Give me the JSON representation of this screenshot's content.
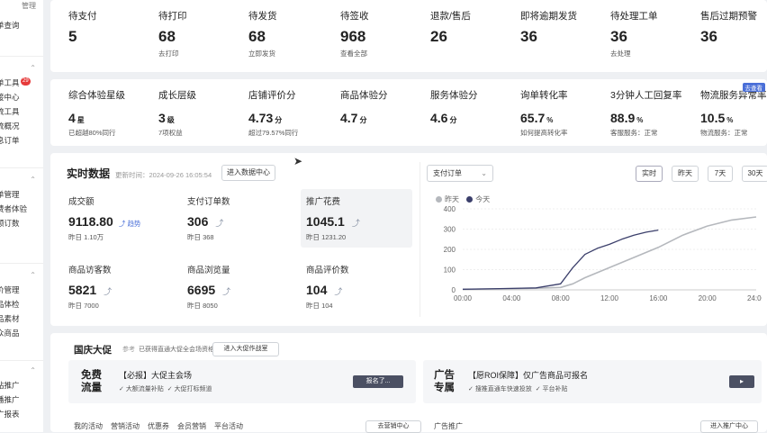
{
  "sidebar": {
    "top": "管理",
    "groups": [
      {
        "items": [
          "单查询"
        ]
      },
      {
        "items": [
          "单工具",
          "接中心",
          "流工具",
          "流概况",
          "息订单"
        ]
      },
      {
        "items": [
          "单管理",
          "费者体验",
          "额订数"
        ]
      },
      {
        "items": [
          "价管理",
          "品体检",
          "品素材",
          "众商品"
        ]
      },
      {
        "items": [
          "站推广",
          "播推广",
          "广报表"
        ]
      }
    ],
    "badge": "29"
  },
  "kpis_row1": [
    {
      "label": "待支付",
      "value": "5",
      "sub": ""
    },
    {
      "label": "待打印",
      "value": "68",
      "sub": "去打印"
    },
    {
      "label": "待发货",
      "value": "68",
      "sub": "立即发货"
    },
    {
      "label": "待签收",
      "value": "968",
      "sub": "查看全部"
    },
    {
      "label": "退款/售后",
      "value": "26",
      "sub": ""
    },
    {
      "label": "即将逾期发货",
      "value": "36",
      "sub": ""
    },
    {
      "label": "待处理工单",
      "value": "36",
      "sub": "去处理"
    },
    {
      "label": "售后过期预警",
      "value": "36",
      "sub": ""
    }
  ],
  "kpis_row2": [
    {
      "label": "综合体验星级",
      "value": "4",
      "unit": "星",
      "sub": "已超越80%同行"
    },
    {
      "label": "成长层级",
      "value": "3",
      "unit": "级",
      "sub": "7项权益"
    },
    {
      "label": "店铺评价分",
      "value": "4.73",
      "unit": "分",
      "sub": "超过79.57%同行"
    },
    {
      "label": "商品体验分",
      "value": "4.7",
      "unit": "分",
      "sub": ""
    },
    {
      "label": "服务体验分",
      "value": "4.6",
      "unit": "分",
      "sub": ""
    },
    {
      "label": "询单转化率",
      "value": "65.7",
      "unit": "%",
      "sub": "如何提高转化率"
    },
    {
      "label": "3分钟人工回复率",
      "value": "88.9",
      "unit": "%",
      "sub": "客服服务：正常"
    },
    {
      "label": "物流服务异常率",
      "value": "10.5",
      "unit": "%",
      "sub": "物流服务：正常",
      "badge": "去查看"
    }
  ],
  "realtime": {
    "title": "实时数据",
    "updated": "更新时间：2024-09-26 16:05:54",
    "enter_btn": "进入数据中心",
    "metrics": [
      {
        "name": "成交额",
        "value": "9118.80",
        "yest": "昨日 1.10万",
        "tag": "趋势"
      },
      {
        "name": "支付订单数",
        "value": "306",
        "yest": "昨日 368"
      },
      {
        "name": "推广花费",
        "value": "1045.1",
        "yest": "昨日 1231.20"
      },
      {
        "name": "商品访客数",
        "value": "5821",
        "yest": "昨日 7000"
      },
      {
        "name": "商品浏览量",
        "value": "6695",
        "yest": "昨日 8050"
      },
      {
        "name": "商品评价数",
        "value": "104",
        "yest": "昨日 104"
      }
    ],
    "chart_select": "支付订单",
    "range_buttons": [
      "实时",
      "昨天",
      "7天",
      "30天"
    ]
  },
  "chart_data": {
    "type": "line",
    "x_ticks": [
      "00:00",
      "04:00",
      "08:00",
      "12:00",
      "16:00",
      "20:00",
      "24:00"
    ],
    "y_ticks": [
      "0",
      "100",
      "200",
      "300",
      "400"
    ],
    "ylim": [
      0,
      400
    ],
    "xlim": [
      0,
      24
    ],
    "series": [
      {
        "name": "昨天",
        "color": "#b5b8bd",
        "x": [
          0,
          2,
          4,
          6,
          8,
          9,
          10,
          11,
          12,
          14,
          16,
          18,
          20,
          22,
          24
        ],
        "y": [
          2,
          4,
          6,
          8,
          12,
          30,
          60,
          85,
          110,
          160,
          210,
          270,
          315,
          345,
          360
        ]
      },
      {
        "name": "今天",
        "color": "#3b3f6b",
        "x": [
          0,
          2,
          4,
          6,
          8,
          9,
          10,
          11,
          12,
          13,
          14,
          15,
          16
        ],
        "y": [
          3,
          5,
          7,
          10,
          30,
          110,
          175,
          205,
          225,
          250,
          270,
          285,
          295
        ]
      }
    ]
  },
  "promo": {
    "title": "国庆大促",
    "tag": "参考",
    "desc": "已获得直通大促全会场资格",
    "btn": "进入大促作战室",
    "left": {
      "big": "免费流量",
      "title": "【必报】大促主会场",
      "checks": [
        "大额流量补贴",
        "大促打标频道"
      ],
      "btn": "报名了..."
    },
    "right": {
      "big": "广告专属",
      "title": "【愿ROI保障】仅广告商品可报名",
      "checks": [
        "搜推直通车快速投放",
        "平台补贴"
      ]
    }
  },
  "bottom_tabs": [
    "我的活动",
    "营销活动",
    "优惠券",
    "会员营销",
    "平台活动"
  ],
  "bottom_btn": "去营销中心",
  "bottom_right": {
    "title": "广告推广",
    "btn": "进入推广中心"
  }
}
